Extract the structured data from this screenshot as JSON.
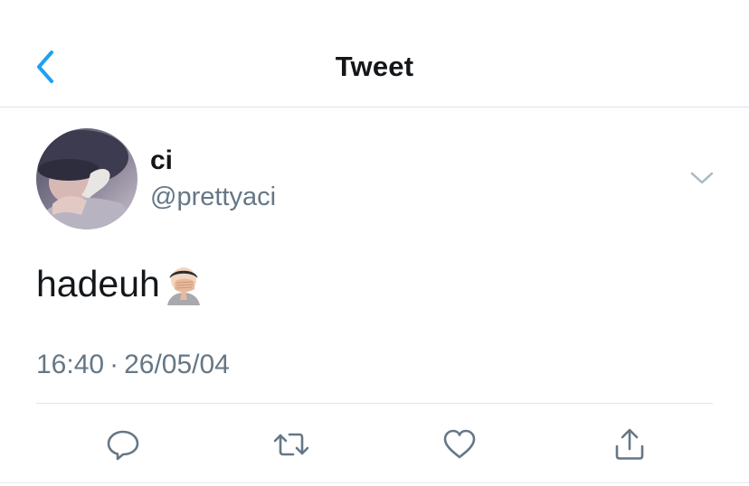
{
  "header": {
    "title": "Tweet",
    "back_icon": "chevron-left-icon"
  },
  "tweet": {
    "author_name": "ci",
    "author_handle": "@prettyaci",
    "text": "hadeuh",
    "emoji_icon": "face-palm-emoji",
    "time": "16:40",
    "separator": "·",
    "date": "26/05/04",
    "more_icon": "chevron-down-icon"
  },
  "actions": {
    "reply_icon": "reply-icon",
    "retweet_icon": "retweet-icon",
    "like_icon": "heart-icon",
    "share_icon": "share-icon"
  },
  "colors": {
    "accent": "#1da1f2",
    "secondary_text": "#657786",
    "icon": "#657786",
    "divider": "#dfe3e8"
  }
}
